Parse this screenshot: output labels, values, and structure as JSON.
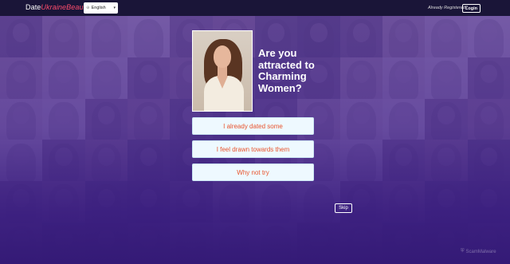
{
  "header": {
    "logo_main": "Date",
    "logo_accent": "Ukraine",
    "logo_tail": "Beauty",
    "language": "English",
    "already_registered": "Already Registered?",
    "login_label": "Login"
  },
  "quiz": {
    "question": "Are you attracted to Charming Women?",
    "answers": [
      "I already dated some",
      "I feel drawn towards them",
      "Why not try"
    ],
    "skip_label": "Skip"
  },
  "watermark": "ScamMalware",
  "colors": {
    "header_bg": "#1a1538",
    "answer_text": "#e8542c",
    "answer_bg": "#eef9ff",
    "logo_accent": "#ff4d6d"
  }
}
